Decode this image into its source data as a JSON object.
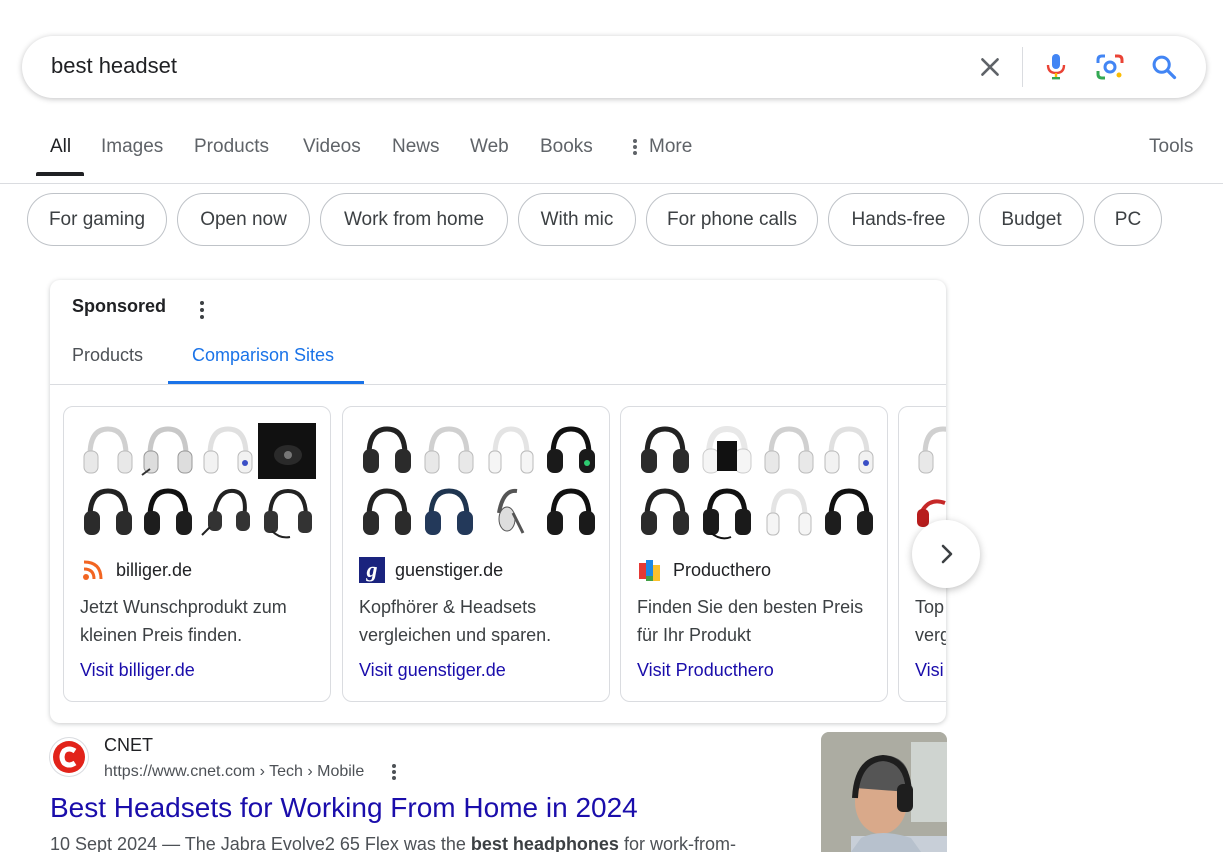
{
  "search": {
    "query": "best headset"
  },
  "nav": {
    "tabs": [
      "All",
      "Images",
      "Products",
      "Videos",
      "News",
      "Web",
      "Books"
    ],
    "more_label": "More",
    "tools_label": "Tools",
    "active_tab": "All"
  },
  "chips": [
    "For gaming",
    "Open now",
    "Work from home",
    "With mic",
    "For phone calls",
    "Hands-free",
    "Budget",
    "PC"
  ],
  "sponsored": {
    "title": "Sponsored",
    "tabs": [
      "Products",
      "Comparison Sites"
    ],
    "active_tab": "Comparison Sites",
    "cards": [
      {
        "site": "billiger.de",
        "logo_icon": "rss-orange-icon",
        "desc": "Jetzt Wunschprodukt zum kleinen Preis finden.",
        "link": "Visit billiger.de"
      },
      {
        "site": "guenstiger.de",
        "logo_icon": "g-logo-icon",
        "desc": "Kopfhörer & Headsets vergleichen und sparen.",
        "link": "Visit guenstiger.de"
      },
      {
        "site": "Producthero",
        "logo_icon": "producthero-logo-icon",
        "desc": "Finden Sie den besten Preis für Ihr Produkt",
        "link": "Visit Producthero"
      },
      {
        "site": "",
        "logo_icon": "",
        "desc": "Top verg",
        "link": "Visi"
      }
    ]
  },
  "result": {
    "site_name": "CNET",
    "url": "https://www.cnet.com › Tech › Mobile",
    "title": "Best Headsets for Working From Home in 2024",
    "snippet_prefix": "10 Sept 2024 — The Jabra Evolve2 65 Flex was the ",
    "snippet_bold": "best headphones",
    "snippet_suffix": " for work-from-"
  },
  "colors": {
    "link": "#1a0dab",
    "accent_blue": "#1a73e8",
    "text_secondary": "#5f6368",
    "cnet_red": "#e2231a"
  }
}
